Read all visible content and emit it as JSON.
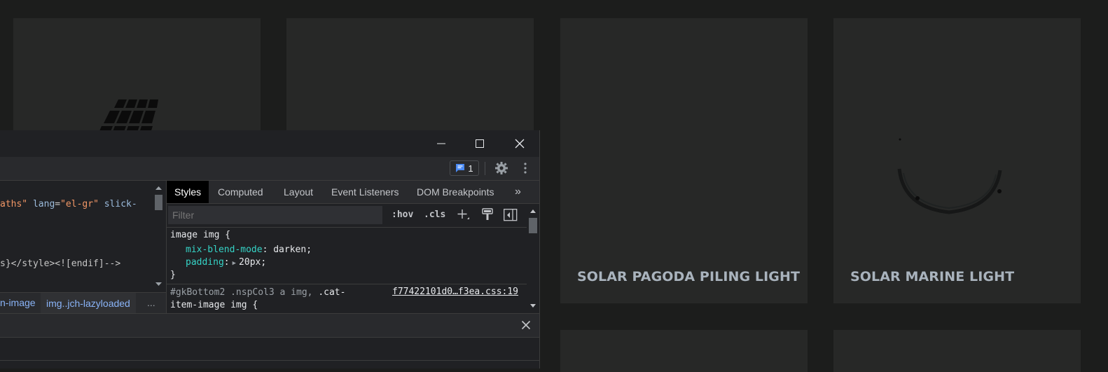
{
  "products": [
    {
      "title": ""
    },
    {
      "title": ""
    },
    {
      "title": "SOLAR PAGODA PILING LIGHT"
    },
    {
      "title": "SOLAR MARINE LIGHT"
    }
  ],
  "devtools": {
    "issues_count": "1",
    "elements": {
      "line1_attr1_val": "aths\"",
      "line1_attr2_name": "lang",
      "line1_attr2_val": "\"el-gr\"",
      "line1_attr3_name": "slick-",
      "line2": "s}</style><![endif]-->"
    },
    "breadcrumbs": [
      "n-image",
      "img..jch-lazyloaded"
    ],
    "breadcrumbs_more": "...",
    "tabs": [
      "Styles",
      "Computed",
      "Layout",
      "Event Listeners",
      "DOM Breakpoints"
    ],
    "tabs_more": "»",
    "filter_placeholder": "Filter",
    "hov": ":hov",
    "cls": ".cls",
    "rule1": {
      "selector": "image img {",
      "decls": [
        {
          "prop": "mix-blend-mode",
          "value": "darken;"
        },
        {
          "prop": "padding",
          "value": "20px;"
        }
      ],
      "close": "}"
    },
    "rule2": {
      "selector_dim": "#gkBottom2 .nspCol3 a img,",
      "selector_main": ".cat-",
      "selector_line2": "item-image img {",
      "source": "f77422101d0…f3ea.css:19"
    }
  }
}
